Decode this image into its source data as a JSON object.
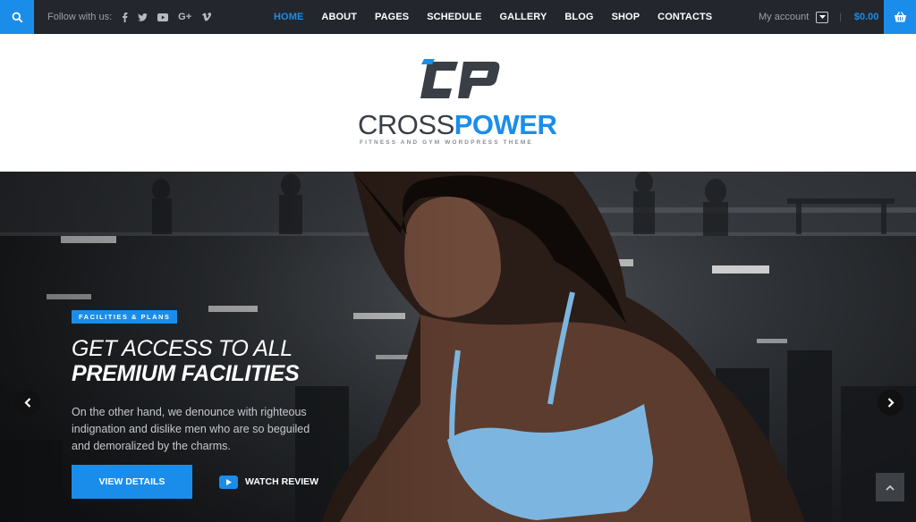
{
  "topbar": {
    "follow_label": "Follow with us:",
    "social": [
      {
        "icon": "facebook-icon",
        "glyph": "f"
      },
      {
        "icon": "twitter-icon",
        "glyph": "🐦"
      },
      {
        "icon": "youtube-icon",
        "glyph": "▶"
      },
      {
        "icon": "google-plus-icon",
        "glyph": "G+"
      },
      {
        "icon": "vimeo-icon",
        "glyph": "V"
      }
    ],
    "nav": [
      "HOME",
      "ABOUT",
      "PAGES",
      "SCHEDULE",
      "GALLERY",
      "BLOG",
      "SHOP",
      "CONTACTS"
    ],
    "active_nav": "HOME",
    "account_label": "My account",
    "cart_total": "$0.00"
  },
  "logo": {
    "brand_part1": "CROSS",
    "brand_part2": "POWER",
    "tagline": "FITNESS AND GYM WORDPRESS THEME"
  },
  "hero": {
    "badge": "FACILITIES & PLANS",
    "title_line1": "GET ACCESS TO ALL",
    "title_line2": "PREMIUM FACILITIES",
    "description": "On the other hand, we denounce with righteous indignation and dislike men who are so beguiled and demoralized by the charms.",
    "primary_button": "VIEW DETAILS",
    "secondary_button": "WATCH REVIEW"
  },
  "colors": {
    "accent": "#1a8dea",
    "topbar_bg": "#23272d",
    "brand_dark": "#3a3f46"
  }
}
